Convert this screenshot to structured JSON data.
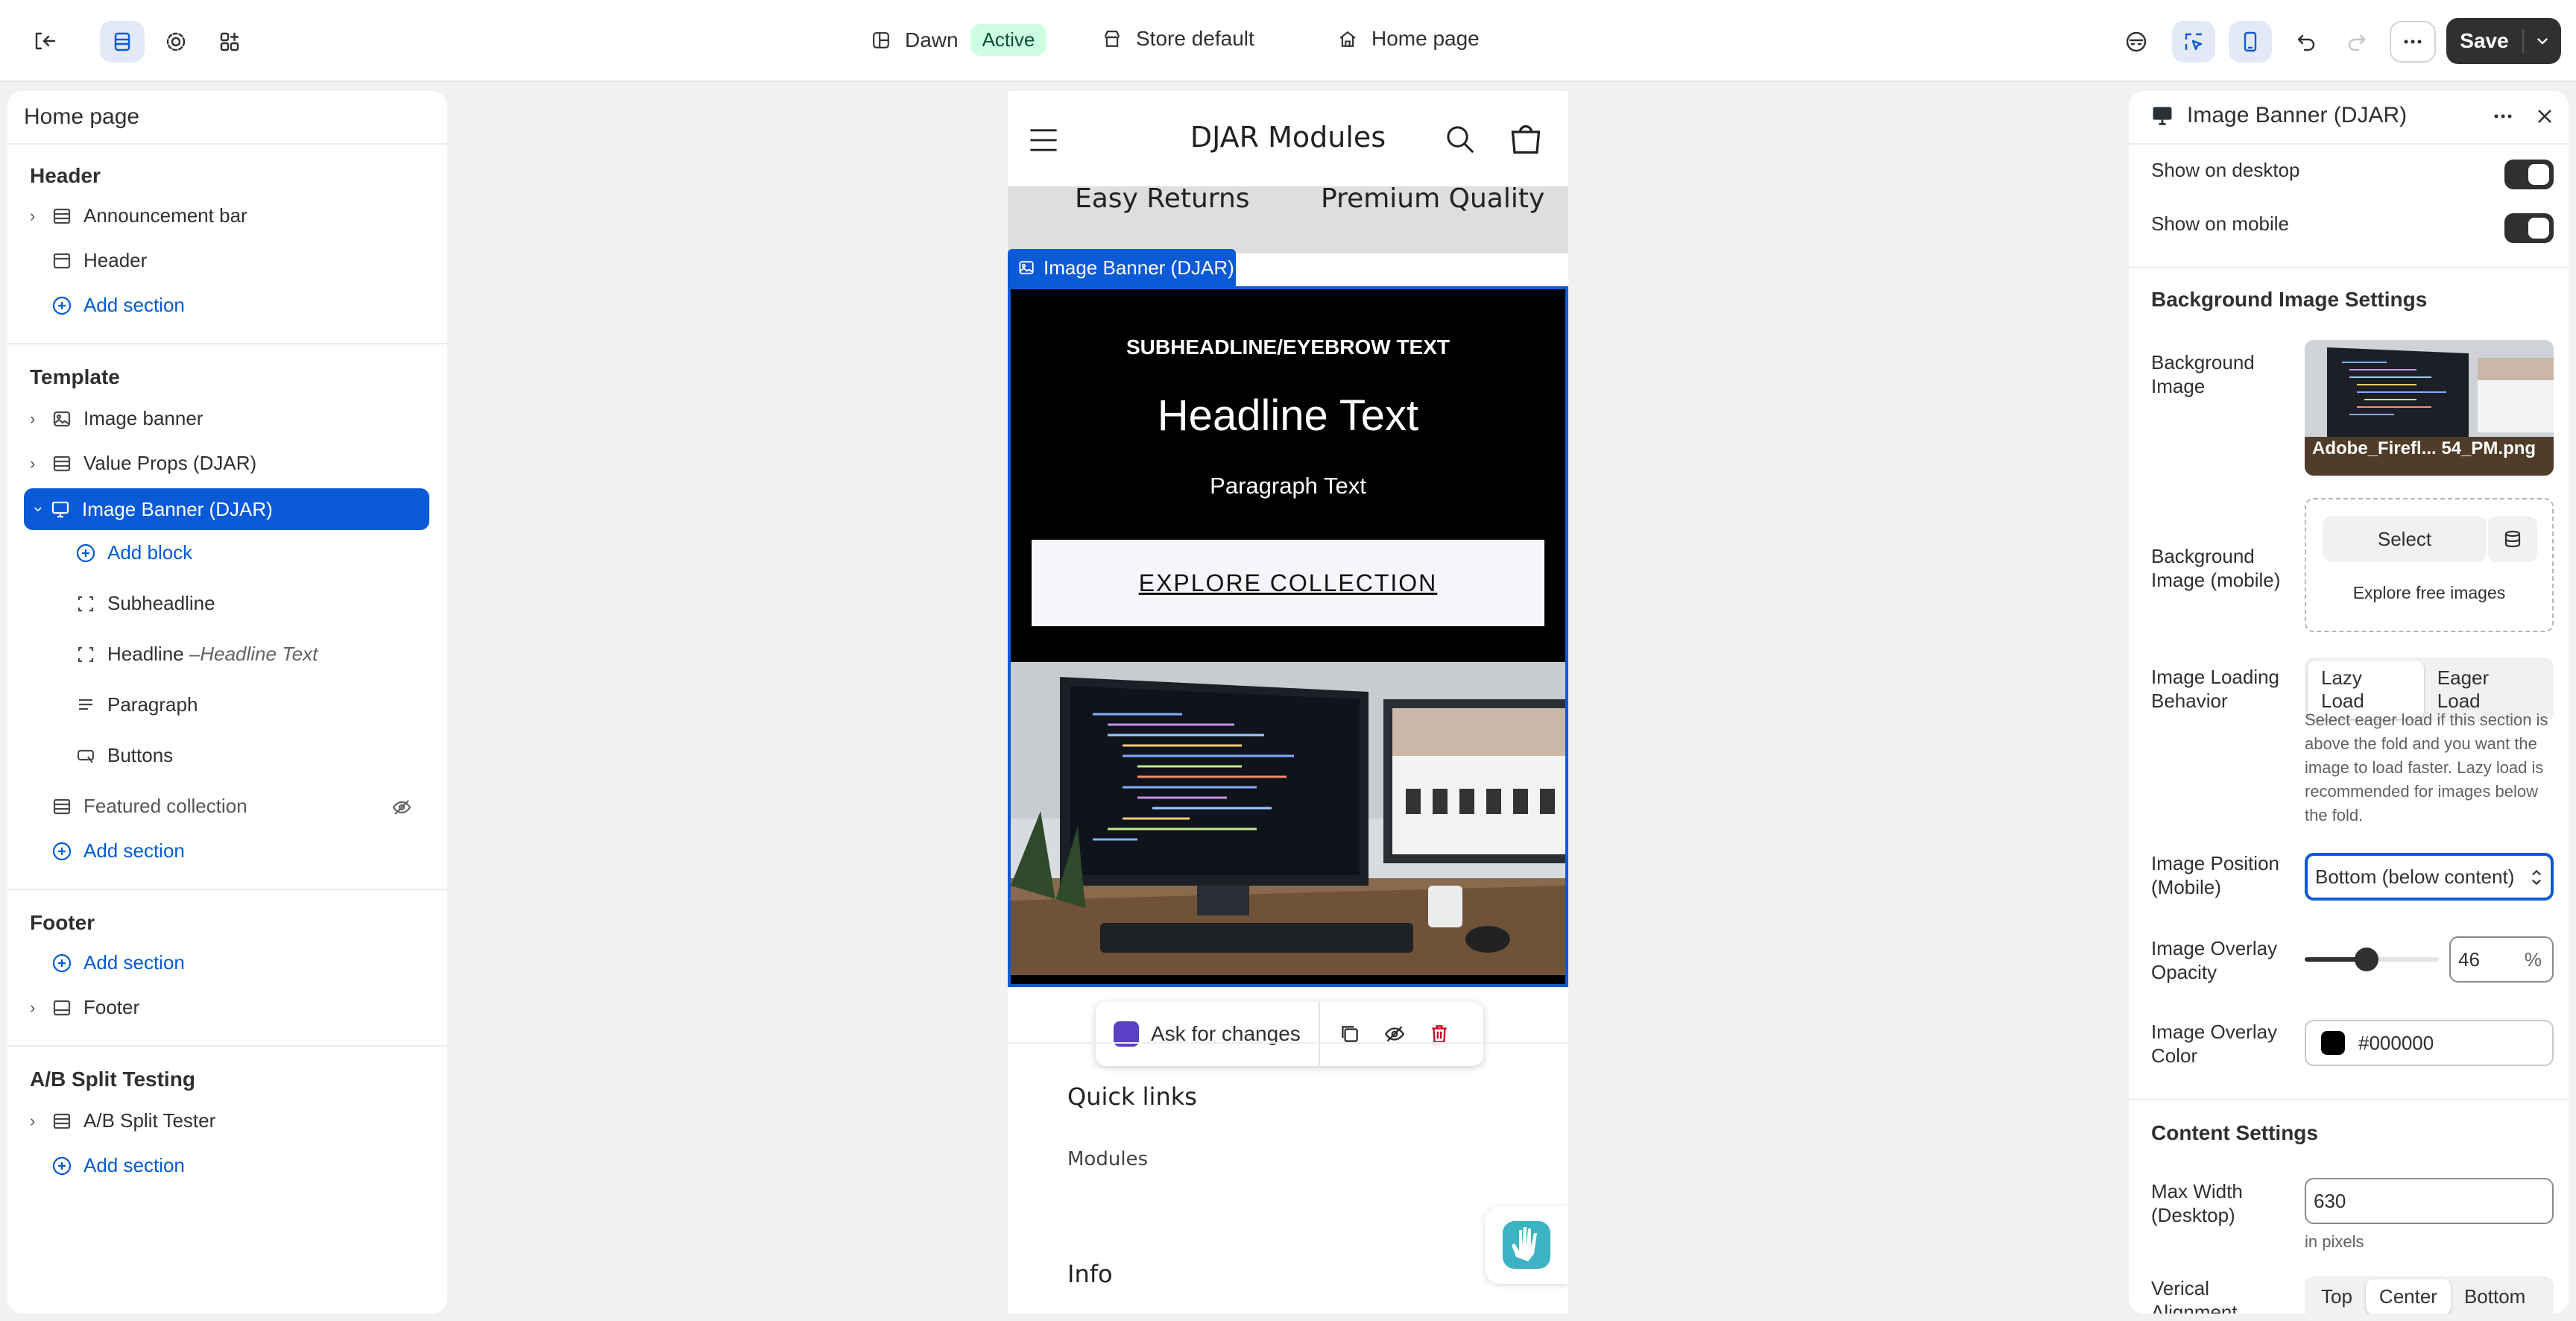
{
  "topbar": {
    "theme_name": "Dawn",
    "theme_status": "Active",
    "store_context": "Store default",
    "page_context": "Home page",
    "save_label": "Save"
  },
  "sidebar": {
    "title": "Home page",
    "header_group": "Header",
    "announcement_bar": "Announcement bar",
    "header_item": "Header",
    "add_section": "Add section",
    "template_group": "Template",
    "image_banner": "Image banner",
    "value_props": "Value Props (DJAR)",
    "image_banner_djar": "Image Banner (DJAR)",
    "add_block": "Add block",
    "subheadline": "Subheadline",
    "headline": "Headline",
    "headline_sep": "– ",
    "headline_value": "Headline Text",
    "paragraph": "Paragraph",
    "buttons": "Buttons",
    "featured_collection": "Featured collection",
    "footer_group": "Footer",
    "footer_item": "Footer",
    "ab_group": "A/B Split Testing",
    "ab_tester": "A/B Split Tester"
  },
  "preview": {
    "store_name": "DJAR Modules",
    "prev_section_left": "Easy Returns",
    "prev_section_right": "Premium Quality",
    "section_tag": "Image Banner (DJAR)",
    "subheadline": "SUBHEADLINE/EYEBROW TEXT",
    "headline": "Headline Text",
    "paragraph": "Paragraph Text",
    "button": "EXPLORE COLLECTION",
    "ask_changes": "Ask for changes",
    "quick_links": "Quick links",
    "modules": "Modules",
    "info": "Info"
  },
  "settings": {
    "title": "Image Banner (DJAR)",
    "show_desktop": "Show on desktop",
    "show_desktop_on": true,
    "show_mobile": "Show on mobile",
    "show_mobile_on": true,
    "bg_heading": "Background Image Settings",
    "bg_image_label": "Background Image",
    "bg_image_file": "Adobe_Firefl... 54_PM.png",
    "bg_mobile_label": "Background Image (mobile)",
    "select_label": "Select",
    "explore_free": "Explore free images",
    "loading_label": "Image Loading Behavior",
    "lazy": "Lazy Load",
    "eager": "Eager Load",
    "loading_help": "Select eager load if this section is above the fold and you want the image to load faster. Lazy load is recommended for images below the fold.",
    "position_label": "Image Position (Mobile)",
    "position_value": "Bottom (below content)",
    "opacity_label": "Image Overlay Opacity",
    "opacity_value": "46",
    "opacity_unit": "%",
    "overlay_color_label": "Image Overlay Color",
    "overlay_color": "#000000",
    "content_heading": "Content Settings",
    "max_width_label": "Max Width (Desktop)",
    "max_width_value": "630",
    "max_width_help": "in pixels",
    "valign_label": "Verical Alignment",
    "valign_top": "Top",
    "valign_center": "Center",
    "valign_bottom": "Bottom"
  },
  "colors": {
    "accent_blue": "#0a5ad8",
    "link_blue": "#005bd3",
    "active_badge_bg": "#cdfee1",
    "banner_bg": "#000000",
    "button_bg": "#f4f6fa"
  }
}
